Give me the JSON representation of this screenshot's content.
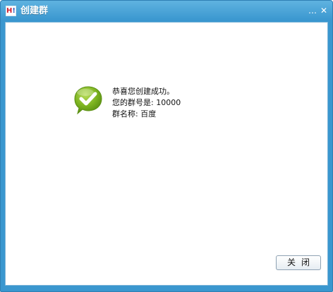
{
  "window": {
    "title": "创建群",
    "icon_label": "H!",
    "min_label": "…",
    "close_label": "✕"
  },
  "message": {
    "line1": "恭喜您创建成功。",
    "line2": "您的群号是: 10000",
    "line3": "群名称: 百度"
  },
  "icons": {
    "success": "check-bubble-icon",
    "app": "app-logo-icon"
  },
  "buttons": {
    "close_label": "关闭"
  },
  "colors": {
    "title_bar": "#3a97cf",
    "success_green": "#7cb320"
  }
}
